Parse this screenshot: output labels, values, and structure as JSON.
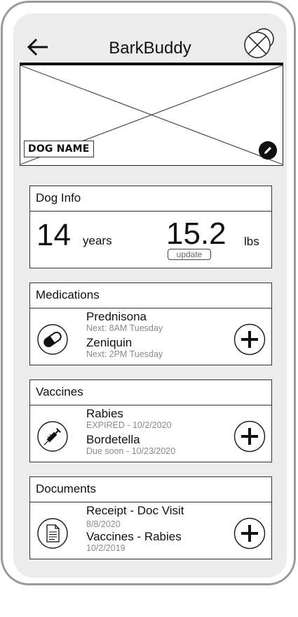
{
  "app": {
    "title": "BarkBuddy"
  },
  "hero": {
    "dog_name": "DOG NAME"
  },
  "dog_info": {
    "heading": "Dog Info",
    "age_value": "14",
    "age_unit": "years",
    "weight_value": "15.2",
    "weight_unit": "lbs",
    "update_label": "update"
  },
  "medications": {
    "heading": "Medications",
    "items": [
      {
        "name": "Prednisona",
        "detail": "Next: 8AM Tuesday"
      },
      {
        "name": "Zeniquin",
        "detail": "Next: 2PM Tuesday"
      }
    ]
  },
  "vaccines": {
    "heading": "Vaccines",
    "items": [
      {
        "name": "Rabies",
        "detail": "EXPIRED - 10/2/2020"
      },
      {
        "name": "Bordetella",
        "detail": "Due soon - 10/23/2020"
      }
    ]
  },
  "documents": {
    "heading": "Documents",
    "items": [
      {
        "name": "Receipt - Doc Visit",
        "detail": "8/8/2020"
      },
      {
        "name": "Vaccines - Rabies",
        "detail": "10/2/2019"
      }
    ]
  },
  "icons": {
    "back": "arrow-left-icon",
    "avatar": "avatar-placeholder-icon",
    "edit": "pencil-icon",
    "medications": "pill-icon",
    "vaccines": "syringe-icon",
    "documents": "document-icon",
    "add": "plus-icon"
  }
}
